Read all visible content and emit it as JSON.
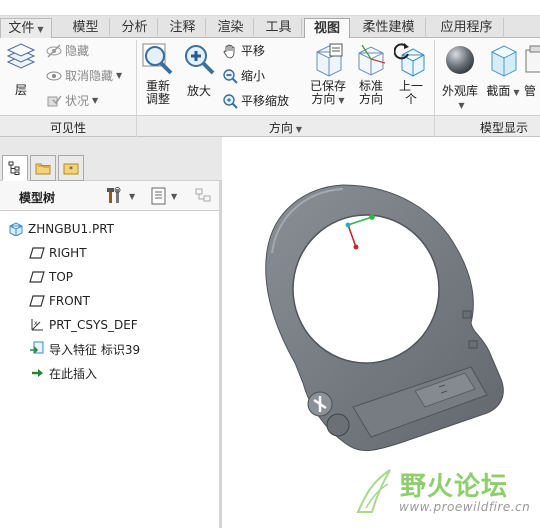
{
  "tabs": [
    {
      "label": "文件",
      "dropdown": true
    },
    {
      "label": "模型"
    },
    {
      "label": "分析"
    },
    {
      "label": "注释"
    },
    {
      "label": "渲染"
    },
    {
      "label": "工具"
    },
    {
      "label": "视图",
      "active": true
    },
    {
      "label": "柔性建模"
    },
    {
      "label": "应用程序"
    }
  ],
  "ribbon": {
    "visibility": {
      "layer_label": "层",
      "hide_label": "隐藏",
      "unhide_label": "取消隐藏",
      "status_label": "状况",
      "group_label": "可见性"
    },
    "orientation": {
      "refit_label_1": "重新",
      "refit_label_2": "调整",
      "zoom_in_label": "放大",
      "pan_label": "平移",
      "zoom_out_label": "缩小",
      "pan_zoom_label": "平移缩放",
      "saved_views_label_1": "已保存",
      "saved_views_label_2": "方向",
      "standard_label_1": "标准",
      "standard_label_2": "方向",
      "previous_label_1": "上一",
      "previous_label_2": "个",
      "group_label": "方向"
    },
    "display": {
      "appearance_label": "外观库",
      "section_label": "截面",
      "manage_label": "管",
      "group_label": "模型显示"
    }
  },
  "model_tree": {
    "title": "模型树",
    "items": [
      {
        "label": "ZHNGBU1.PRT",
        "icon": "part-icon"
      },
      {
        "label": "RIGHT",
        "icon": "datum-plane-icon"
      },
      {
        "label": "TOP",
        "icon": "datum-plane-icon"
      },
      {
        "label": "FRONT",
        "icon": "datum-plane-icon"
      },
      {
        "label": "PRT_CSYS_DEF",
        "icon": "csys-icon"
      },
      {
        "label": "导入特征 标识39",
        "icon": "import-feature-icon"
      },
      {
        "label": "在此插入",
        "icon": "insert-arrow-icon"
      }
    ]
  },
  "watermark": {
    "text": "野火论坛",
    "url": "www.proewildfire.cn"
  },
  "colors": {
    "model_gray": "#7b8088",
    "watermark_green": "#8ccf6b",
    "active_tab_bg": "#fafafa"
  }
}
